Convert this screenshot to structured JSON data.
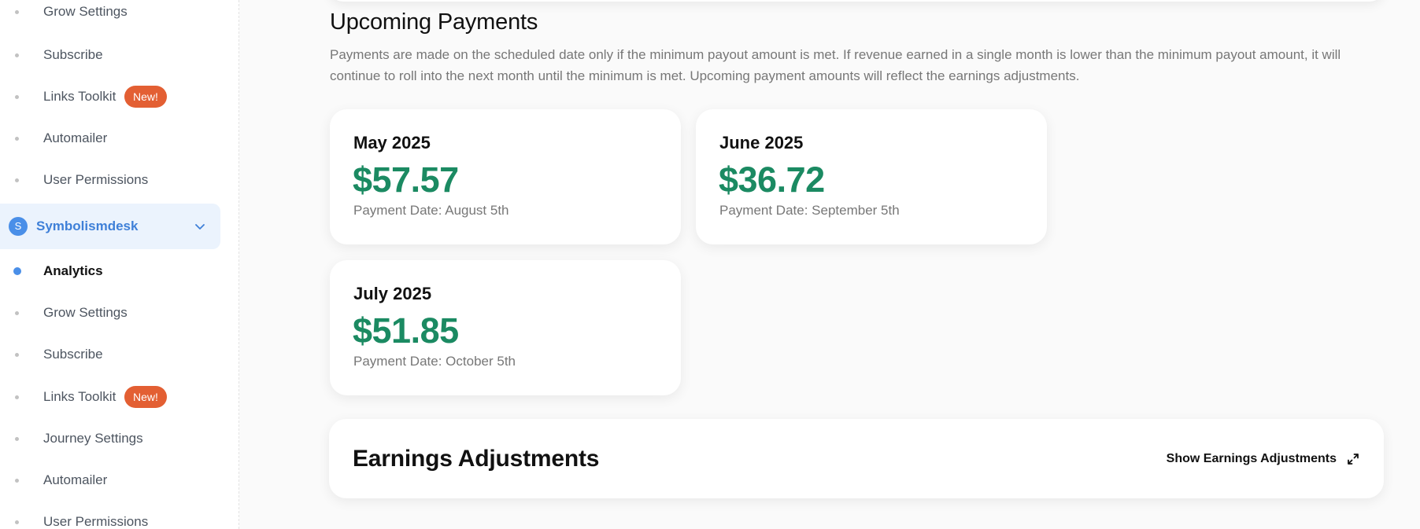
{
  "sidebar": {
    "items_top": [
      {
        "label": "Grow Settings",
        "badge": ""
      },
      {
        "label": "Subscribe",
        "badge": ""
      },
      {
        "label": "Links Toolkit",
        "badge": "New!"
      },
      {
        "label": "Automailer",
        "badge": ""
      },
      {
        "label": "User Permissions",
        "badge": ""
      }
    ],
    "site": {
      "avatar_letter": "S",
      "name": "Symbolismdesk",
      "chevron_icon": "chevron-down-icon"
    },
    "items_site": [
      {
        "label": "Analytics",
        "badge": "",
        "active": true
      },
      {
        "label": "Grow Settings",
        "badge": ""
      },
      {
        "label": "Subscribe",
        "badge": ""
      },
      {
        "label": "Links Toolkit",
        "badge": "New!"
      },
      {
        "label": "Journey Settings",
        "badge": ""
      },
      {
        "label": "Automailer",
        "badge": ""
      },
      {
        "label": "User Permissions",
        "badge": ""
      }
    ]
  },
  "upcoming": {
    "title": "Upcoming Payments",
    "description": "Payments are made on the scheduled date only if the minimum payout amount is met. If revenue earned in a single month is lower than the minimum payout amount, it will continue to roll into the next month until the minimum is met. Upcoming payment amounts will reflect the earnings adjustments.",
    "cards": [
      {
        "month": "May 2025",
        "amount": "$57.57",
        "date": "Payment Date: August 5th"
      },
      {
        "month": "June 2025",
        "amount": "$36.72",
        "date": "Payment Date: September 5th"
      },
      {
        "month": "July 2025",
        "amount": "$51.85",
        "date": "Payment Date: October 5th"
      }
    ]
  },
  "adjustments": {
    "title": "Earnings Adjustments",
    "button_label": "Show Earnings Adjustments",
    "button_icon": "expand-icon"
  },
  "colors": {
    "accent_blue": "#4a8fe8",
    "amount_green": "#1b8a62",
    "badge_orange": "#e35f33"
  }
}
